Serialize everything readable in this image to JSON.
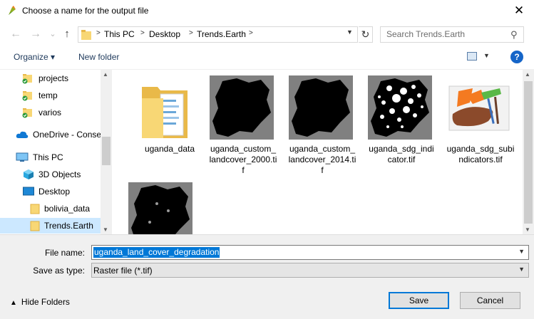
{
  "window": {
    "title": "Choose a name for the output file",
    "close_glyph": "✕"
  },
  "nav": {
    "back": "←",
    "forward": "→",
    "recent": "⌄",
    "up": "↑"
  },
  "address": {
    "separators": [
      ">",
      ">",
      ">",
      ">"
    ],
    "crumbs": [
      "This PC",
      "Desktop",
      "Trends.Earth"
    ]
  },
  "search": {
    "placeholder": "Search Trends.Earth"
  },
  "toolbar": {
    "organize": "Organize ▾",
    "new_folder": "New folder",
    "help": "?"
  },
  "sidebar": {
    "items": [
      {
        "label": "projects",
        "icon": "folder-check-icon"
      },
      {
        "label": "temp",
        "icon": "folder-check-icon"
      },
      {
        "label": "varios",
        "icon": "folder-check-icon"
      },
      {
        "label": "OneDrive - Conse",
        "icon": "onedrive-cloud-icon"
      },
      {
        "label": "This PC",
        "icon": "computer-icon"
      },
      {
        "label": "3D Objects",
        "icon": "cube-icon"
      },
      {
        "label": "Desktop",
        "icon": "desktop-icon"
      },
      {
        "label": "bolivia_data",
        "icon": "folder-icon"
      },
      {
        "label": "Trends.Earth",
        "icon": "folder-icon",
        "selected": true
      }
    ]
  },
  "files": [
    {
      "name": "uganda_data",
      "kind": "folder"
    },
    {
      "name": "uganda_custom_landcover_2000.tif",
      "display": "uganda_custom_\nlandcover_2000.ti\nf",
      "kind": "raster-dark"
    },
    {
      "name": "uganda_custom_landcover_2014.tif",
      "display": "uganda_custom_\nlandcover_2014.ti\nf",
      "kind": "raster-dark"
    },
    {
      "name": "uganda_sdg_indicator.tif",
      "display": "uganda_sdg_indi\ncator.tif",
      "kind": "raster-speckle"
    },
    {
      "name": "uganda_sdg_subindicators.tif",
      "display": "uganda_sdg_subi\nndicators.tif",
      "kind": "paint-icon"
    },
    {
      "name": "",
      "kind": "raster-dark"
    }
  ],
  "form": {
    "filename_label": "File name:",
    "filename_value": "uganda_land_cover_degradation",
    "savetype_label": "Save as type:",
    "savetype_value": "Raster file (*.tif)"
  },
  "actions": {
    "hide_folders": "Hide Folders",
    "save": "Save",
    "cancel": "Cancel"
  },
  "colors": {
    "accent": "#0078d7",
    "selected_bg": "#cce8ff",
    "folder_yellow": "#f8d775"
  }
}
